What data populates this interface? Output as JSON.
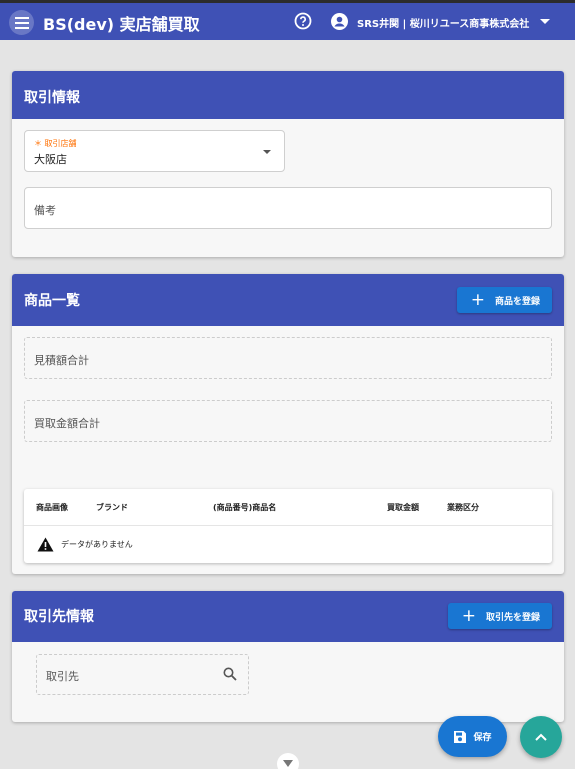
{
  "header": {
    "title": "BS(dev) 実店舗買取",
    "user": "SRS井関 | 桜川リユース商事株式会社"
  },
  "transaction_info": {
    "title": "取引情報",
    "store_label": "取引店舗",
    "store_value": "大阪店",
    "memo_placeholder": "備考"
  },
  "product_list": {
    "title": "商品一覧",
    "register_button": "商品を登録",
    "estimate_total_label": "見積額合計",
    "purchase_total_label": "買取金額合計",
    "columns": [
      "商品画像",
      "ブランド",
      "(商品番号)商品名",
      "買取金額",
      "業務区分"
    ],
    "empty_message": "データがありません"
  },
  "partner_info": {
    "title": "取引先情報",
    "register_button": "取引先を登録",
    "search_placeholder": "取引先"
  },
  "actions": {
    "save_label": "保存"
  },
  "colors": {
    "primary": "#3f51b5",
    "button": "#1976d2",
    "fab_top": "#26a69a",
    "required_label": "#ff6f00"
  },
  "icons": [
    "menu-icon",
    "help-icon",
    "account-icon",
    "caret-down-icon",
    "plus-icon",
    "warning-icon",
    "search-icon",
    "save-icon",
    "chevron-up-icon",
    "chevron-down-icon"
  ]
}
